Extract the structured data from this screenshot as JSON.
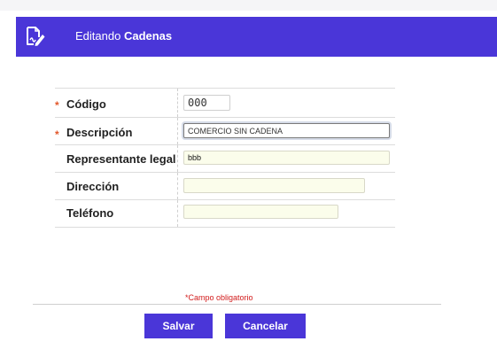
{
  "header": {
    "prefix": "Editando",
    "entity": "Cadenas",
    "icon": "edit-document-icon"
  },
  "form": {
    "required_mark": "*",
    "fields": [
      {
        "label": "Código",
        "value": "000",
        "required": true
      },
      {
        "label": "Descripción",
        "value": "COMERCIO SIN CADENA",
        "required": true
      },
      {
        "label": "Representante legal",
        "value": "bbb",
        "required": false
      },
      {
        "label": "Dirección",
        "value": "",
        "required": false
      },
      {
        "label": "Teléfono",
        "value": "",
        "required": false
      }
    ]
  },
  "footer": {
    "required_note": "*Campo obligatorio",
    "save_label": "Salvar",
    "cancel_label": "Cancelar"
  },
  "colors": {
    "accent": "#4a36d8",
    "required": "#e2572a",
    "input_bg": "#fbfdeb"
  }
}
